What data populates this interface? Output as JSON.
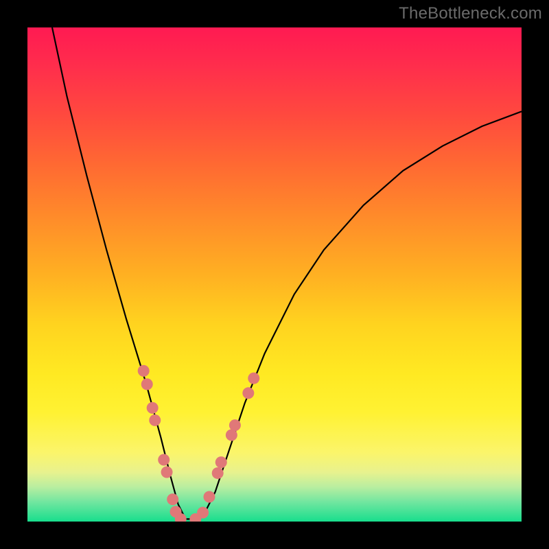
{
  "watermark": "TheBottleneck.com",
  "chart_data": {
    "type": "line",
    "title": "",
    "xlabel": "",
    "ylabel": "",
    "xlim": [
      0,
      100
    ],
    "ylim": [
      0,
      100
    ],
    "grid": false,
    "series": [
      {
        "name": "curve",
        "x": [
          5,
          8,
          12,
          16,
          20,
          24,
          27,
          29,
          30.5,
          32,
          34,
          36,
          38,
          40,
          44,
          48,
          54,
          60,
          68,
          76,
          84,
          92,
          100
        ],
        "y": [
          100,
          86,
          70,
          55,
          41,
          28,
          17,
          9,
          3.5,
          0.5,
          0.5,
          2,
          6,
          12,
          24,
          34,
          46,
          55,
          64,
          71,
          76,
          80,
          83
        ]
      }
    ],
    "markers_left": {
      "name": "left-dots",
      "x": [
        23.5,
        24.2,
        25.3,
        25.8,
        27.6,
        28.2,
        29.4,
        30.0
      ],
      "y": [
        30.5,
        27.8,
        23.0,
        20.5,
        12.5,
        10.0,
        4.5,
        2.0
      ]
    },
    "markers_right": {
      "name": "right-dots",
      "x": [
        35.5,
        36.8,
        38.5,
        39.2,
        41.3,
        42.0,
        44.7,
        45.8
      ],
      "y": [
        1.8,
        5.0,
        9.8,
        12.0,
        17.5,
        19.5,
        26.0,
        29.0
      ]
    },
    "markers_bottom": {
      "name": "bottom-dots",
      "x": [
        31.0,
        34.0
      ],
      "y": [
        0.5,
        0.5
      ]
    },
    "colors": {
      "curve": "#000000",
      "dot_fill": "#e07878",
      "dot_stroke": "#d05a5a",
      "background_top": "#ff1a52",
      "background_bottom": "#18de8d"
    }
  }
}
